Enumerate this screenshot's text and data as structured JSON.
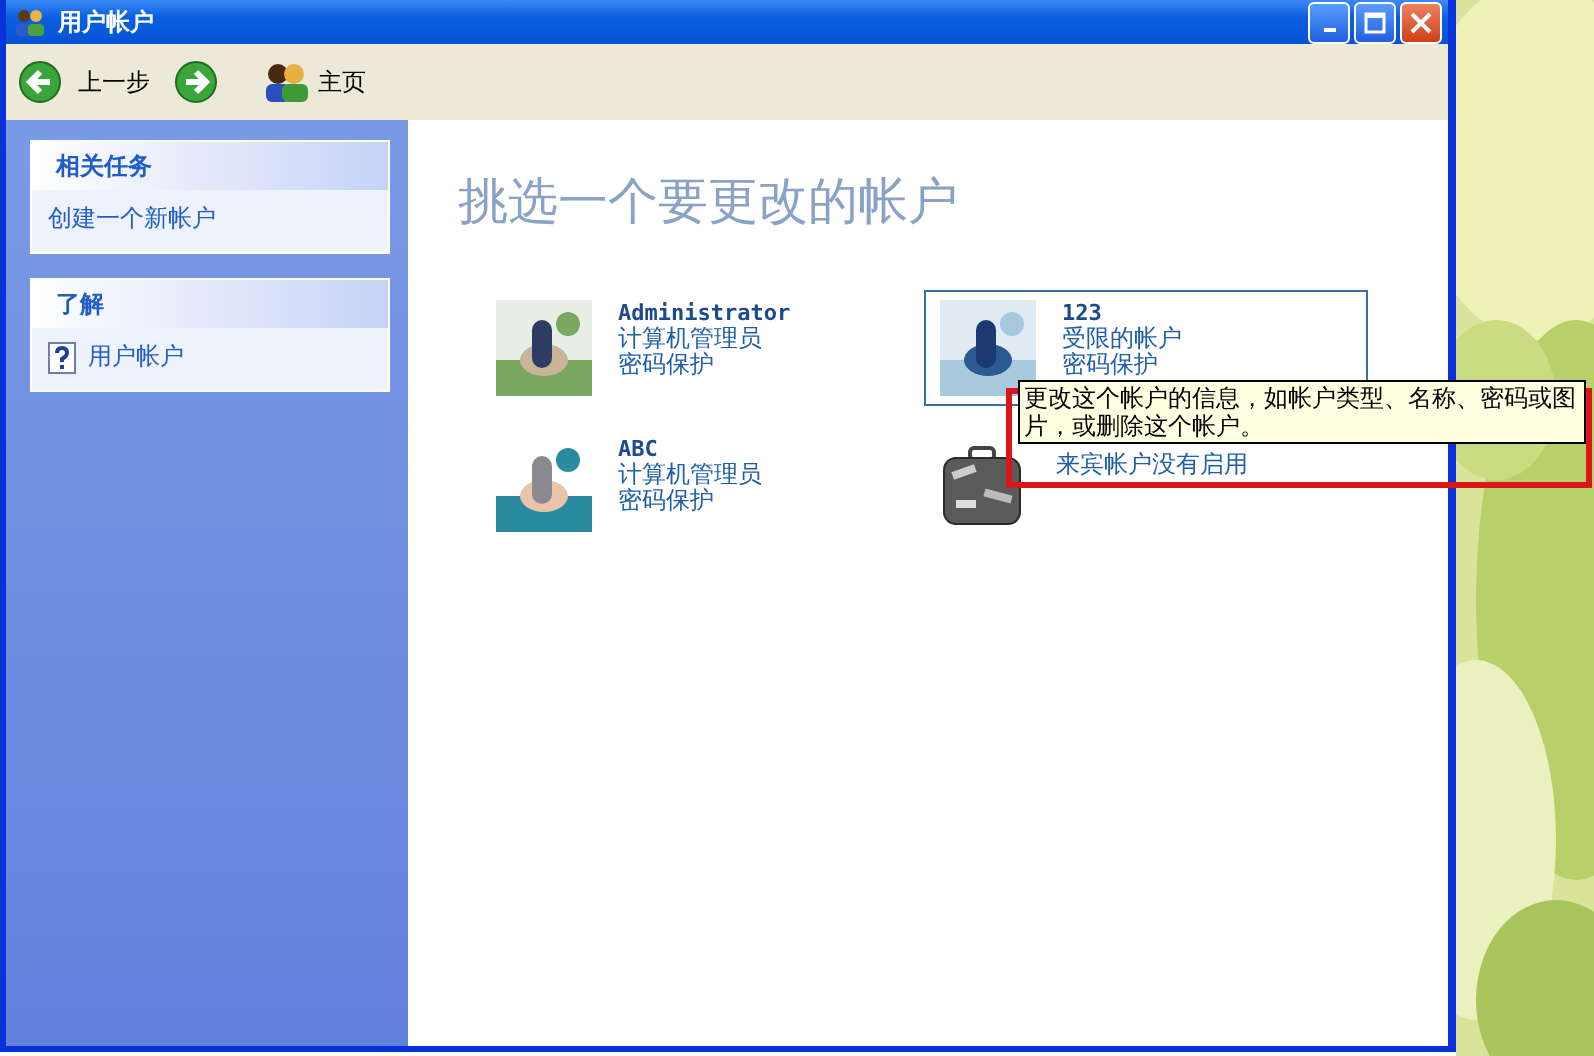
{
  "window": {
    "title": "用户帐户"
  },
  "toolbar": [
    {
      "kind": "back",
      "label": "上一步"
    },
    {
      "kind": "forward"
    },
    {
      "kind": "home",
      "label": "主页"
    }
  ],
  "sidebar": {
    "panels": [
      {
        "title": "相关任务",
        "items": [
          {
            "kind": "task",
            "label": "创建一个新帐户"
          }
        ]
      },
      {
        "title": "了解",
        "items": [
          {
            "kind": "help",
            "label": "用户帐户"
          }
        ]
      }
    ]
  },
  "content": {
    "heading": "挑选一个要更改的帐户",
    "accounts": [
      {
        "kind": "user",
        "name": "Administrator",
        "type": "计算机管理员",
        "password": "密码保护",
        "selected": false
      },
      {
        "kind": "user",
        "name": "123",
        "type": "受限的帐户",
        "password": "密码保护",
        "selected": true
      },
      {
        "kind": "user",
        "name": "ABC",
        "type": "计算机管理员",
        "password": "密码保护",
        "selected": false
      },
      {
        "kind": "guest",
        "status": "来宾帐户没有启用",
        "selected": false
      }
    ]
  },
  "tooltip": {
    "text": "更改这个帐户的信息，如帐户类型、名称、密码或图片，或删除这个帐户。"
  }
}
